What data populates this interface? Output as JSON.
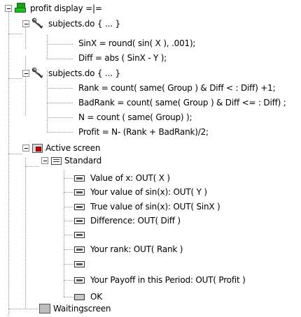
{
  "tree": {
    "root": {
      "label": "profit display =|=",
      "icon": "program-icon"
    },
    "program1": {
      "label": "subjects.do { ... }",
      "icon": "wrench-icon",
      "lines": [
        "SinX = round( sin( X ), .001);",
        "Diff = abs ( SinX - Y );"
      ]
    },
    "program2": {
      "label": "subjects.do { ... }",
      "icon": "wrench-icon",
      "lines": [
        "Rank = count( same( Group ) &  Diff < : Diff) +1;",
        "BadRank = count( same( Group ) & Diff <= : Diff) ;",
        "N = count ( same( Group) );",
        "Profit = N- (Rank + BadRank)/2;"
      ]
    },
    "active_screen": {
      "label": "Active screen",
      "icon": "screen-icon"
    },
    "standard": {
      "label": "Standard",
      "icon": "box-icon"
    },
    "items": [
      "Value of x: OUT( X )",
      "Your value of sin(x): OUT( Y )",
      "True value of sin(x): OUT( SinX )",
      "Difference: OUT( Diff )",
      "",
      "Your rank: OUT( Rank )",
      "",
      "Your Payoff in this Period: OUT( Profit )"
    ],
    "button": {
      "label": "OK",
      "icon": "button-icon"
    },
    "waiting_screen": {
      "label": "Waitingscreen",
      "icon": "screen-icon"
    }
  }
}
